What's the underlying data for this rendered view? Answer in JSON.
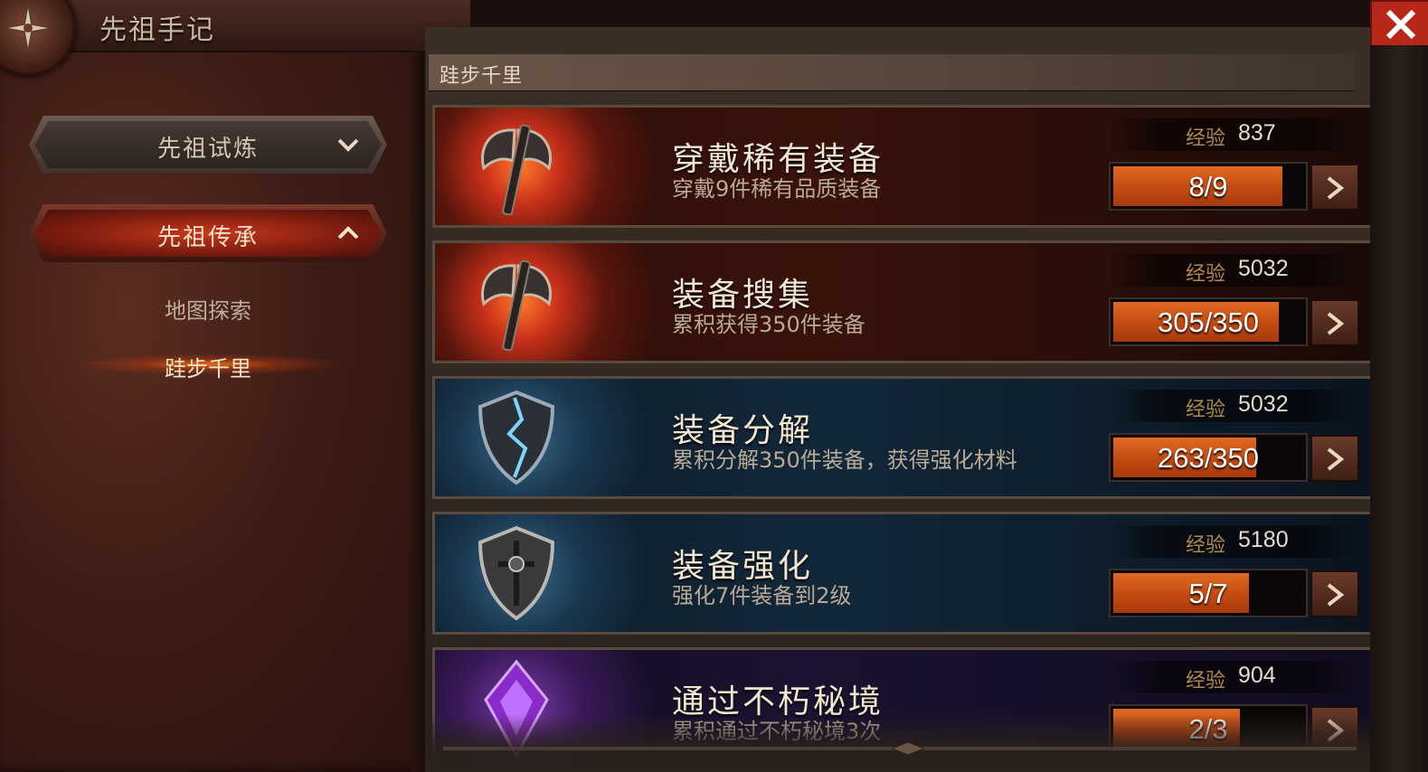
{
  "header": {
    "title": "先祖手记"
  },
  "sidebar": {
    "menus": [
      {
        "label": "先祖试炼",
        "state": "collapsed",
        "chevron": "chevron-down-icon"
      },
      {
        "label": "先祖传承",
        "state": "expanded",
        "chevron": "chevron-up-icon"
      }
    ],
    "submenu": [
      {
        "label": "地图探索",
        "selected": false
      },
      {
        "label": "跬步千里",
        "selected": true
      }
    ]
  },
  "main": {
    "section_title": "跬步千里",
    "exp_label": "经验",
    "tasks": [
      {
        "title": "穿戴稀有装备",
        "desc": "穿戴9件稀有品质装备",
        "exp": "837",
        "progress_text": "8/9",
        "progress_fraction": 0.889,
        "icon": "axe-icon",
        "theme": "red"
      },
      {
        "title": "装备搜集",
        "desc": "累积获得350件装备",
        "exp": "5032",
        "progress_text": "305/350",
        "progress_fraction": 0.871,
        "icon": "axe-icon",
        "theme": "red"
      },
      {
        "title": "装备分解",
        "desc": "累积分解350件装备，获得强化材料",
        "exp": "5032",
        "progress_text": "263/350",
        "progress_fraction": 0.751,
        "icon": "broken-shield-icon",
        "theme": "blue"
      },
      {
        "title": "装备强化",
        "desc": "强化7件装备到2级",
        "exp": "5180",
        "progress_text": "5/7",
        "progress_fraction": 0.714,
        "icon": "shield-icon",
        "theme": "blue"
      },
      {
        "title": "通过不朽秘境",
        "desc": "累积通过不朽秘境3次",
        "exp": "904",
        "progress_text": "2/3",
        "progress_fraction": 0.667,
        "icon": "purple-crystal-icon",
        "theme": "purple"
      }
    ]
  },
  "colors": {
    "accent_orange": "#d0561a",
    "close_red": "#b8281a",
    "exp_gold": "#b08a4a"
  },
  "icons": {
    "close": "close-icon",
    "go": "arrow-right-icon",
    "emblem": "compass-emblem-icon"
  }
}
